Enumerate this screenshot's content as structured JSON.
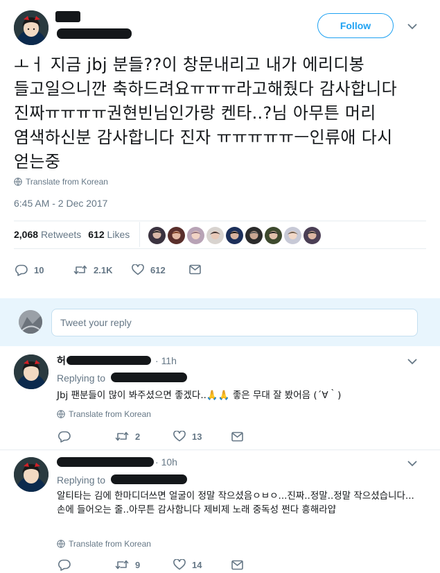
{
  "main_tweet": {
    "follow_label": "Follow",
    "text": "ㅗㅓ 지금 jbj 분들??이 창문내리고 내가 에리디봉 들고일으니깐 축하드려요ㅠㅠㅠ라고해줬다 감사합니다 진짜ㅠㅠㅠㅠ권현빈님인가랑 켄타..?님 아무튼 머리 염색하신분 감사합니다 진자 ㅠㅠㅠㅠㅠㅡ인류애 다시 얻는중",
    "translate_label": "Translate from Korean",
    "timestamp": "6:45 AM - 2 Dec 2017",
    "retweets_count": "2,068",
    "retweets_label": "Retweets",
    "likes_count": "612",
    "likes_label": "Likes",
    "actions": {
      "reply_count": "10",
      "retweet_count": "2.1K",
      "like_count": "612"
    }
  },
  "reply_box": {
    "placeholder": "Tweet your reply"
  },
  "replies": [
    {
      "name_visible": "허",
      "time": "11h",
      "replying_to": "Replying to",
      "text": "Jbj 팬분들이 많이 봐주셨으면 좋겠다..🙏🙏 좋은 무대 잘 봤어음 (´∀｀)",
      "translate_label": "Translate from Korean",
      "retweet_count": "2",
      "like_count": "13"
    },
    {
      "time": "10h",
      "replying_to": "Replying to",
      "text": "알티타는 김에 한마디더쓰면 얼굴이 정말 작으셨음ㅇㅂㅇ...진짜..정말..정말 작으셨습니다...손에 들어오는 줄..아무튼 감사함니다 제비제 노래 중독성 쩐다 흥해라얍",
      "translate_label": "Translate from Korean",
      "retweet_count": "9",
      "like_count": "14"
    }
  ],
  "colors": {
    "accent": "#1da1f2",
    "muted": "#657786",
    "text": "#14171a",
    "band": "#e8f5fd",
    "like_red": "#e0245e"
  },
  "icons": [
    "globe-icon",
    "reply-icon",
    "retweet-icon",
    "heart-icon",
    "message-icon",
    "chevron-down-icon"
  ]
}
